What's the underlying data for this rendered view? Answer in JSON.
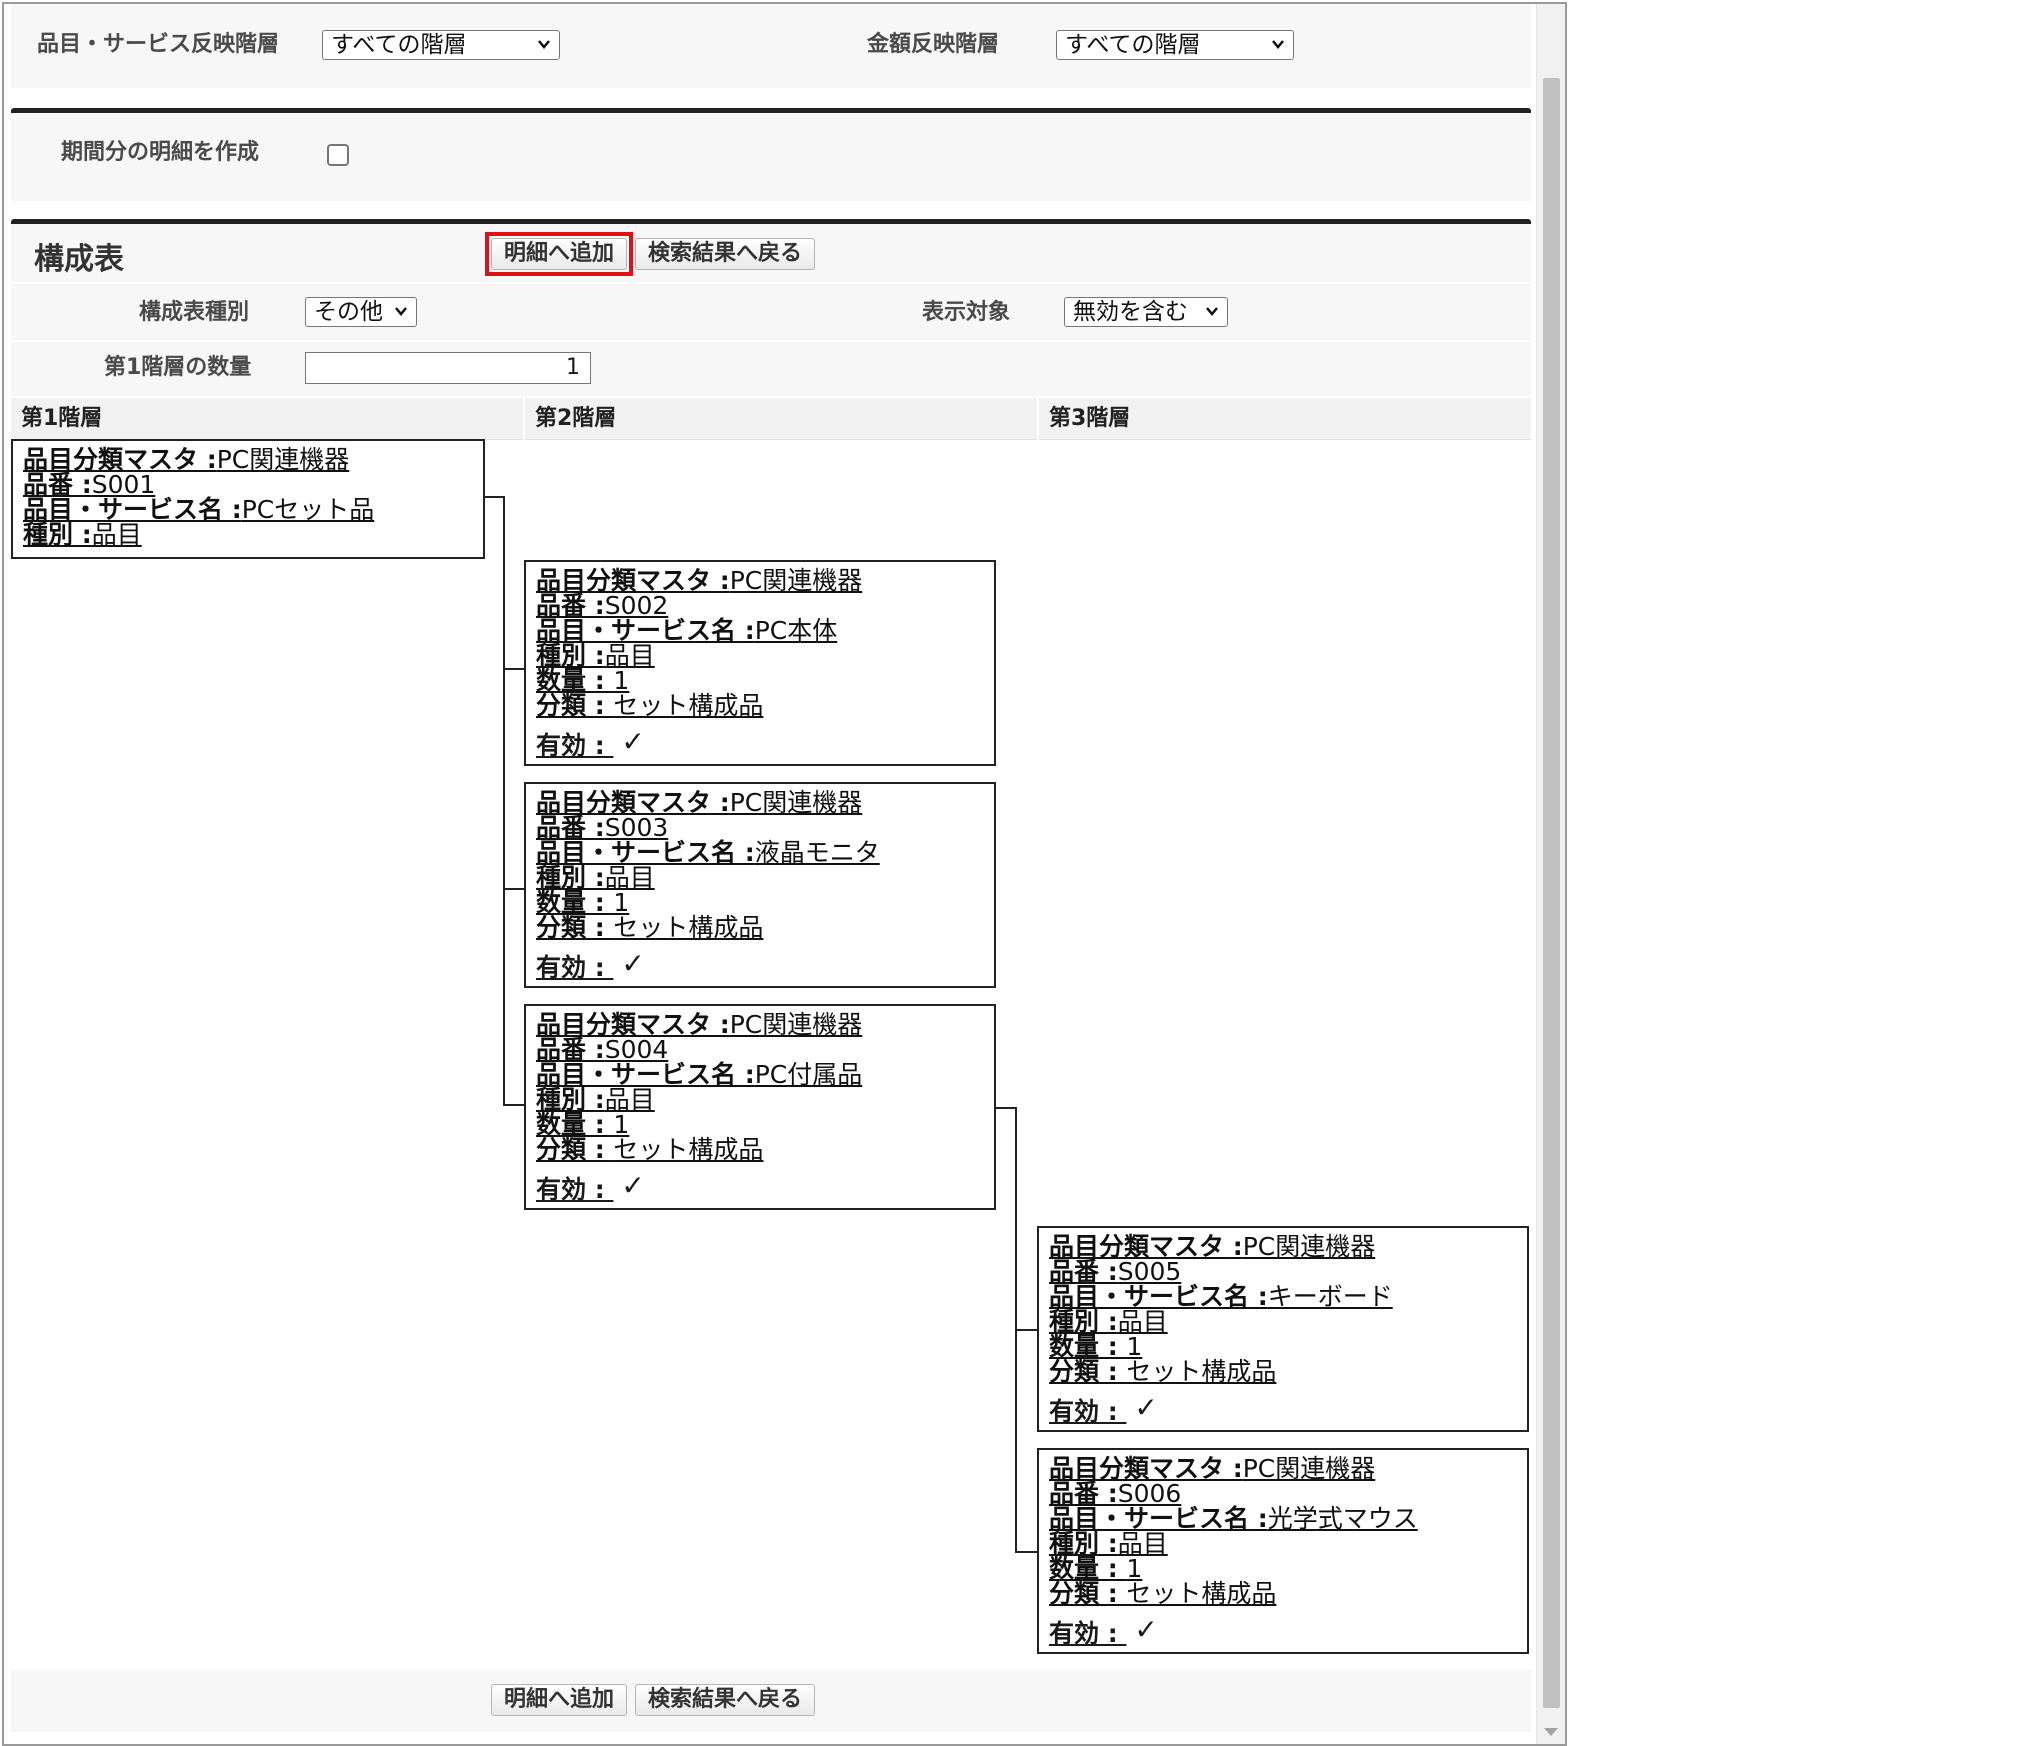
{
  "filters": {
    "item_layer_label": "品目・サービス反映階層",
    "item_layer_value": "すべての階層",
    "amount_layer_label": "金額反映階層",
    "amount_layer_value": "すべての階層"
  },
  "period": {
    "label": "期間分の明細を作成",
    "checked": false
  },
  "composition": {
    "title": "構成表",
    "add_button": "明細へ追加",
    "back_button": "検索結果へ戻る",
    "type_label": "構成表種別",
    "type_value": "その他",
    "display_label": "表示対象",
    "display_value": "無効を含む",
    "qty_label": "第1階層の数量",
    "qty_value": "1"
  },
  "columns": [
    "第1階層",
    "第2階層",
    "第3階層"
  ],
  "nodes": [
    {
      "master_label": "品目分類マスタ",
      "master": "PC関連機器",
      "code_label": "品番",
      "code": "S001",
      "name_label": "品目・サービス名",
      "name": "PCセット品",
      "kind_label": "種別",
      "kind": "品目"
    },
    {
      "master_label": "品目分類マスタ",
      "master": "PC関連機器",
      "code_label": "品番",
      "code": "S002",
      "name_label": "品目・サービス名",
      "name": "PC本体",
      "kind_label": "種別",
      "kind": "品目",
      "qty_label": "数量",
      "qty": "1",
      "class_label": "分類",
      "class": "セット構成品",
      "valid_label": "有効",
      "valid": "✓"
    },
    {
      "master_label": "品目分類マスタ",
      "master": "PC関連機器",
      "code_label": "品番",
      "code": "S003",
      "name_label": "品目・サービス名",
      "name": "液晶モニタ",
      "kind_label": "種別",
      "kind": "品目",
      "qty_label": "数量",
      "qty": "1",
      "class_label": "分類",
      "class": "セット構成品",
      "valid_label": "有効",
      "valid": "✓"
    },
    {
      "master_label": "品目分類マスタ",
      "master": "PC関連機器",
      "code_label": "品番",
      "code": "S004",
      "name_label": "品目・サービス名",
      "name": "PC付属品",
      "kind_label": "種別",
      "kind": "品目",
      "qty_label": "数量",
      "qty": "1",
      "class_label": "分類",
      "class": "セット構成品",
      "valid_label": "有効",
      "valid": "✓"
    },
    {
      "master_label": "品目分類マスタ",
      "master": "PC関連機器",
      "code_label": "品番",
      "code": "S005",
      "name_label": "品目・サービス名",
      "name": "キーボード",
      "kind_label": "種別",
      "kind": "品目",
      "qty_label": "数量",
      "qty": "1",
      "class_label": "分類",
      "class": "セット構成品",
      "valid_label": "有効",
      "valid": "✓"
    },
    {
      "master_label": "品目分類マスタ",
      "master": "PC関連機器",
      "code_label": "品番",
      "code": "S006",
      "name_label": "品目・サービス名",
      "name": "光学式マウス",
      "kind_label": "種別",
      "kind": "品目",
      "qty_label": "数量",
      "qty": "1",
      "class_label": "分類",
      "class": "セット構成品",
      "valid_label": "有効",
      "valid": "✓"
    }
  ],
  "footer": {
    "add_button": "明細へ追加",
    "back_button": "検索結果へ戻る"
  }
}
